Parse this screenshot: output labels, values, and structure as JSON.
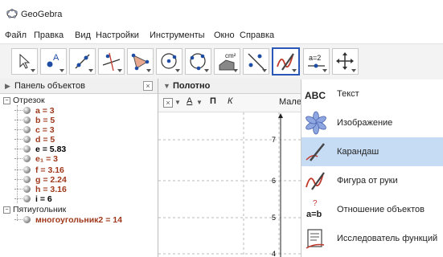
{
  "window": {
    "title": "GeoGebra"
  },
  "menu": [
    "Файл",
    "Правка",
    "Вид",
    "Настройки",
    "Инструменты",
    "Окно",
    "Справка"
  ],
  "toolbar": {
    "tools": [
      "move-tool",
      "point-tool",
      "line-tool",
      "perpendicular-tool",
      "polygon-tool",
      "circle-tool",
      "conic-tool",
      "measurement-tool",
      "reflect-tool",
      "freehand-tool",
      "slider-tool",
      "move-graphics-view-tool"
    ],
    "selected": "freehand-tool",
    "slider_label": "a=2",
    "measure_label": "cm²"
  },
  "algebra": {
    "title": "Панель объектов",
    "close": "×",
    "groups": [
      {
        "name": "Отрезок",
        "items": [
          {
            "text": "a = 3",
            "color": "#a0381b"
          },
          {
            "text": "b = 5",
            "color": "#a0381b"
          },
          {
            "text": "c = 3",
            "color": "#a0381b"
          },
          {
            "text": "d = 5",
            "color": "#a0381b"
          },
          {
            "text": "e = 5.83",
            "color": "#000000"
          },
          {
            "text": "e₁ = 3",
            "color": "#a0381b"
          },
          {
            "text": "f = 3.16",
            "color": "#a0381b"
          },
          {
            "text": "g = 2.24",
            "color": "#a0381b"
          },
          {
            "text": "h = 3.16",
            "color": "#a0381b"
          },
          {
            "text": "i = 6",
            "color": "#000000"
          }
        ]
      },
      {
        "name": "Пятиугольник",
        "items": [
          {
            "text": "многоугольник2 = 14",
            "color": "#a0381b"
          }
        ]
      }
    ]
  },
  "graphics": {
    "title": "Полотно",
    "style_bar": {
      "bold": "П",
      "italic": "К",
      "size": "Мале"
    },
    "y_ticks": [
      "7",
      "6",
      "5",
      "4"
    ]
  },
  "dropdown": {
    "items": [
      {
        "icon": "text-icon",
        "label": "Текст",
        "selected": false
      },
      {
        "icon": "image-icon",
        "label": "Изображение",
        "selected": false
      },
      {
        "icon": "pen-icon",
        "label": "Карандаш",
        "selected": true
      },
      {
        "icon": "freehand-shape-icon",
        "label": "Фигура от руки",
        "selected": false
      },
      {
        "icon": "relation-icon",
        "label": "Отношение объектов",
        "selected": false
      },
      {
        "icon": "function-inspector-icon",
        "label": "Исследователь функций",
        "selected": false
      }
    ],
    "text_icon_label": "ABC",
    "relation_icon_label": "a=b",
    "relation_icon_q": "?"
  },
  "colors": {
    "accent": "#2b58b8",
    "selected_bg": "#c6dcf4",
    "value_color": "#a0381b"
  }
}
